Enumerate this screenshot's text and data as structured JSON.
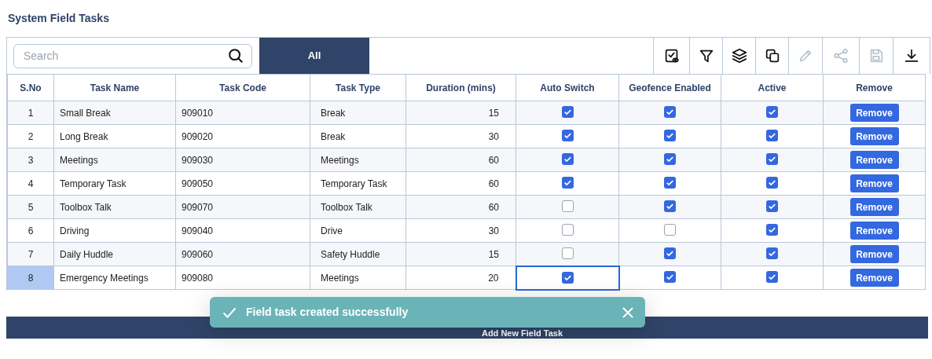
{
  "page_title": "System Field Tasks",
  "search": {
    "placeholder": "Search"
  },
  "filter_tabs": [
    {
      "label": "All",
      "selected": true
    }
  ],
  "toolbar": [
    {
      "kind": "view-check",
      "disabled": false
    },
    {
      "kind": "filter",
      "disabled": false
    },
    {
      "kind": "layers",
      "disabled": false
    },
    {
      "kind": "copy",
      "disabled": false
    },
    {
      "kind": "edit",
      "disabled": true
    },
    {
      "kind": "share",
      "disabled": true
    },
    {
      "kind": "save",
      "disabled": true
    },
    {
      "kind": "download",
      "disabled": false
    }
  ],
  "table": {
    "columns": [
      "S.No",
      "Task Name",
      "Task Code",
      "Task Type",
      "Duration (mins)",
      "Auto Switch",
      "Geofence Enabled",
      "Active",
      "Remove"
    ],
    "rows": [
      {
        "sno": "1",
        "name": "Small Break",
        "code": "909010",
        "type": "Break",
        "duration": "15",
        "auto_switch": true,
        "geofence": true,
        "active": true,
        "remove": "Remove",
        "selected": false
      },
      {
        "sno": "2",
        "name": "Long Break",
        "code": "909020",
        "type": "Break",
        "duration": "30",
        "auto_switch": true,
        "geofence": true,
        "active": true,
        "remove": "Remove",
        "selected": false
      },
      {
        "sno": "3",
        "name": "Meetings",
        "code": "909030",
        "type": "Meetings",
        "duration": "60",
        "auto_switch": true,
        "geofence": true,
        "active": true,
        "remove": "Remove",
        "selected": false
      },
      {
        "sno": "4",
        "name": "Temporary Task",
        "code": "909050",
        "type": "Temporary Task",
        "duration": "60",
        "auto_switch": true,
        "geofence": true,
        "active": true,
        "remove": "Remove",
        "selected": false
      },
      {
        "sno": "5",
        "name": "Toolbox Talk",
        "code": "909070",
        "type": "Toolbox Talk",
        "duration": "60",
        "auto_switch": false,
        "geofence": true,
        "active": true,
        "remove": "Remove",
        "selected": false
      },
      {
        "sno": "6",
        "name": "Driving",
        "code": "909040",
        "type": "Drive",
        "duration": "30",
        "auto_switch": false,
        "geofence": false,
        "active": true,
        "remove": "Remove",
        "selected": false
      },
      {
        "sno": "7",
        "name": "Daily Huddle",
        "code": "909060",
        "type": "Safety Huddle",
        "duration": "15",
        "auto_switch": false,
        "geofence": true,
        "active": true,
        "remove": "Remove",
        "selected": false
      },
      {
        "sno": "8",
        "name": "Emergency Meetings",
        "code": "909080",
        "type": "Meetings",
        "duration": "20",
        "auto_switch": true,
        "geofence": true,
        "active": true,
        "remove": "Remove",
        "selected": true
      }
    ]
  },
  "add_button": "Add New Field Task",
  "toast": {
    "message": "Field task created successfully"
  }
}
